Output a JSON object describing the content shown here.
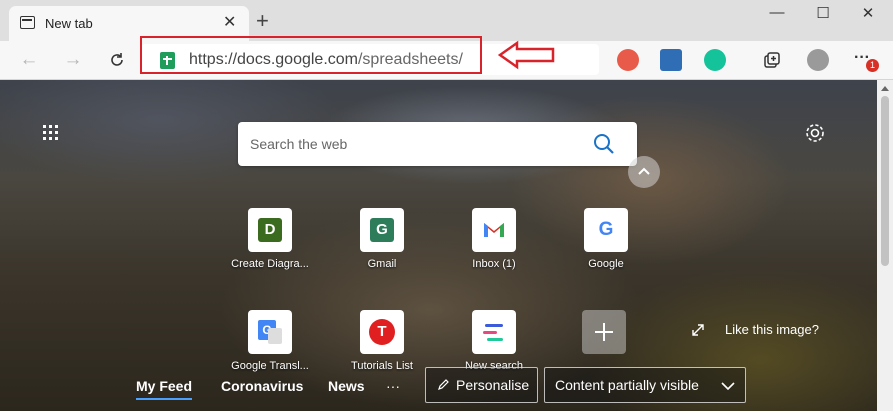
{
  "window": {
    "tab_title": "New tab",
    "tab_close": "✕",
    "new_tab": "+",
    "minimize": "—",
    "maximize": "☐",
    "close": "✕"
  },
  "toolbar": {
    "back": "←",
    "forward": "→",
    "url_host": "https://docs.google.com",
    "url_path": "/spreadsheets/",
    "more": "···",
    "notification_count": "1"
  },
  "newtab": {
    "search_placeholder": "Search the web",
    "tiles_row1": [
      {
        "label": "Create Diagra...",
        "letter": "D",
        "color": "#3a6b1f"
      },
      {
        "label": "Gmail",
        "letter": "G",
        "color": "#2e7d5a"
      },
      {
        "label": "Inbox (1)",
        "letter": "M",
        "color": "#d93025"
      },
      {
        "label": "Google",
        "letter": "G",
        "color": "#4285f4"
      }
    ],
    "tiles_row2": [
      {
        "label": "Google Transl..."
      },
      {
        "label": "Tutorials List",
        "letter": "T",
        "color": "#e02020"
      },
      {
        "label": "New search"
      }
    ],
    "like_image": "Like this image?",
    "feed_tabs": [
      "My Feed",
      "Coronavirus",
      "News"
    ],
    "feed_more": "···",
    "personalise": "Personalise",
    "content_visibility": "Content partially visible"
  }
}
